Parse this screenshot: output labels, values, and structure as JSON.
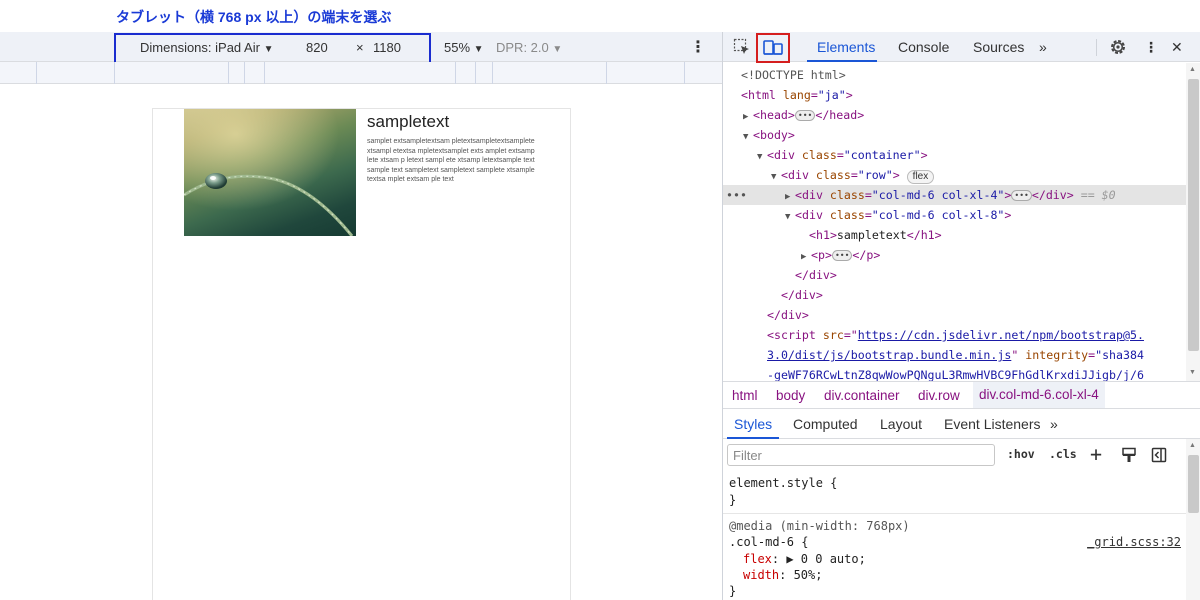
{
  "annotation": "タブレット（横 768 px 以上）の端末を選ぶ",
  "device_toolbar": {
    "dimensions_label": "Dimensions: iPad Air",
    "dropdown_arrow": "▼",
    "width": "820",
    "times": "×",
    "height": "1180",
    "zoom": "55%",
    "zoom_arrow": "▼",
    "dpr": "DPR: 2.0",
    "dpr_arrow": "▼",
    "menu": "⋮"
  },
  "site": {
    "heading": "sampletext",
    "paragraph": "samplet extsampletextsam pletextsampletextsamplete xtsampl etextsa mpletextsamplet exts amplet extsamp lete xtsam p letext sampl ete xtsamp letextsample text sample text sampletext sampletext samplete xtsample textsa mplet extsam ple text"
  },
  "devtools": {
    "tabs": [
      "Elements",
      "Console",
      "Sources"
    ],
    "more_tabs": "»",
    "menu": "⋮",
    "close": "✕"
  },
  "dom": {
    "doctype": "<!DOCTYPE html>",
    "html_open": "<html",
    "html_lang_attr": "lang",
    "html_lang_val": "\"ja\"",
    "head": "<head>",
    "head_close": "</head>",
    "body": "<body>",
    "container_open": "<div",
    "class_attr": "class",
    "container_val": "\"container\"",
    "row_val": "\"row\"",
    "flex_badge": "flex",
    "col4_val": "\"col-md-6 col-xl-4\"",
    "div_close": "</div>",
    "eq_dollar": "== $0",
    "col8_val": "\"col-md-6 col-xl-8\"",
    "h1_text": "sampletext",
    "p_open": "<p>",
    "p_close": "</p>",
    "script_open": "<script",
    "src_attr": "src",
    "src_url_1": "https://cdn.jsdelivr.net/npm/bootstrap@5.",
    "src_url_2": "3.0/dist/js/bootstrap.bundle.min.js",
    "integrity_attr": "integrity",
    "integrity_val_1": "\"sha384",
    "integrity_val_2": "-geWF76RCwLtnZ8qwWowPQNguL3RmwHVBC9FhGdlKrxdiJJigb/j/6",
    "row_dots": "•••"
  },
  "breadcrumbs": [
    "html",
    "body",
    "div.container",
    "div.row",
    "div.col-md-6.col-xl-4"
  ],
  "styles_tabs": [
    "Styles",
    "Computed",
    "Layout",
    "Event Listeners"
  ],
  "styles_more": "»",
  "filter": {
    "placeholder": "Filter",
    "hov": ":hov",
    "cls": ".cls",
    "plus": "+"
  },
  "styles": {
    "element_style": "element.style {",
    "close_brace": "}",
    "media_query": "@media (min-width: 768px)",
    "selector": ".col-md-6 {",
    "source": "_grid.scss:32",
    "prop_flex": "flex",
    "val_flex": "▶ 0 0 auto;",
    "prop_width": "width",
    "val_width": "50%;"
  }
}
